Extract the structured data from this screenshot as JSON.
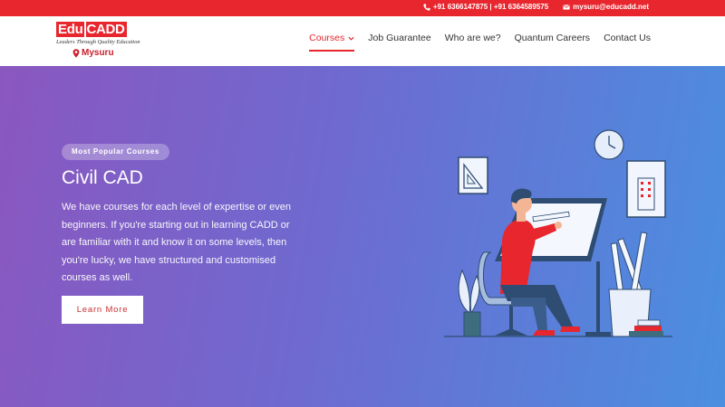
{
  "topbar": {
    "phone": "+91 6366147875 | +91 6364589575",
    "email": "mysuru@educadd.net"
  },
  "brand": {
    "logo_edu": "Edu",
    "logo_cadd": "CADD",
    "tagline": "Leaders Through Quality Education",
    "city": "Mysuru",
    "color": "#e8262e"
  },
  "nav": {
    "items": [
      {
        "label": "Courses",
        "active": true
      },
      {
        "label": "Job Guarantee"
      },
      {
        "label": "Who are we?"
      },
      {
        "label": "Quantum Careers"
      },
      {
        "label": "Contact Us"
      }
    ]
  },
  "hero": {
    "badge": "Most Popular Courses",
    "title": "Civil CAD",
    "description": "We have courses for each level of expertise or even beginners. If you're starting out in learning CADD or are familiar with it and know it on some levels, then you're lucky, we have structured and customised courses as well.",
    "cta_label": "Learn More",
    "gradient_start": "#8a57bf",
    "gradient_end": "#4a8fe0"
  },
  "icons": [
    "phone-icon",
    "mail-icon",
    "pin-icon",
    "chevron-down-icon"
  ]
}
